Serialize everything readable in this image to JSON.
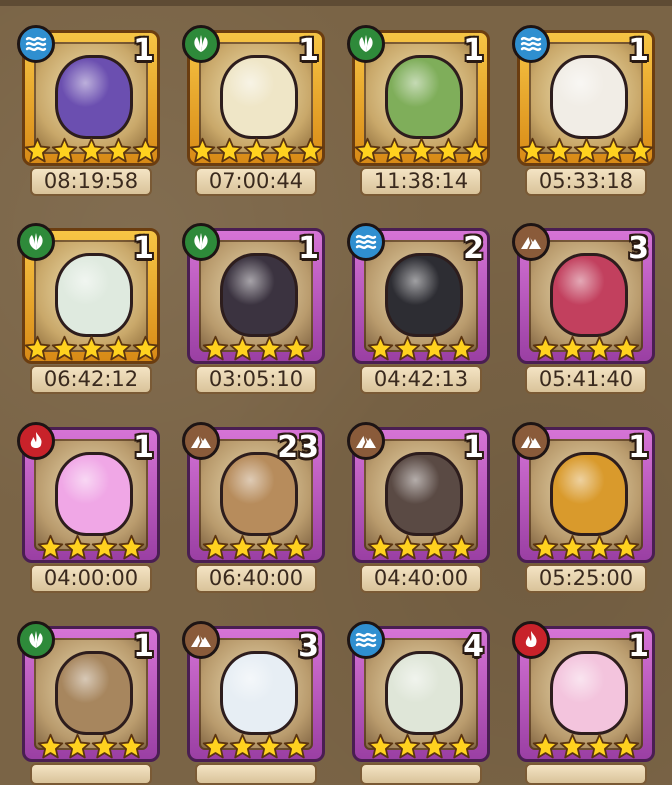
{
  "colors": {
    "background": "#7a6446",
    "gold_frame": "#f7c545",
    "purple_frame": "#d674d6",
    "star": "#ffd21f",
    "water": "#2f8fd0",
    "grass": "#2e8a3a",
    "fire": "#c8222a",
    "earth": "#8a5b3a"
  },
  "eggs": [
    {
      "element": "water",
      "element_icon": "water-waves-icon",
      "frame": "gold",
      "stars": 5,
      "count": "1",
      "timer": "08:19:58",
      "art": "pocket-watch-egg",
      "art_color": "#6b4fb0"
    },
    {
      "element": "grass",
      "element_icon": "leaf-icon",
      "frame": "gold",
      "stars": 5,
      "count": "1",
      "timer": "07:00:44",
      "art": "seed-sack-egg",
      "art_color": "#efe6c7"
    },
    {
      "element": "grass",
      "element_icon": "leaf-icon",
      "frame": "gold",
      "stars": 5,
      "count": "1",
      "timer": "11:38:14",
      "art": "green-egg-on-cloth",
      "art_color": "#7fae5a"
    },
    {
      "element": "water",
      "element_icon": "water-waves-icon",
      "frame": "gold",
      "stars": 5,
      "count": "1",
      "timer": "05:33:18",
      "art": "winged-angel-egg",
      "art_color": "#f1ede6"
    },
    {
      "element": "grass",
      "element_icon": "leaf-icon",
      "frame": "gold",
      "stars": 5,
      "count": "1",
      "timer": "06:42:12",
      "art": "leafy-white-egg",
      "art_color": "#dfeadf"
    },
    {
      "element": "grass",
      "element_icon": "leaf-icon",
      "frame": "purple",
      "stars": 4,
      "count": "1",
      "timer": "03:05:10",
      "art": "horned-dark-egg",
      "art_color": "#3b3340"
    },
    {
      "element": "water",
      "element_icon": "water-waves-icon",
      "frame": "purple",
      "stars": 4,
      "count": "2",
      "timer": "04:42:13",
      "art": "spiked-black-egg",
      "art_color": "#2d2d33"
    },
    {
      "element": "earth",
      "element_icon": "mountain-icon",
      "frame": "purple",
      "stars": 4,
      "count": "3",
      "timer": "05:41:40",
      "art": "thorn-pink-egg",
      "art_color": "#c2405e"
    },
    {
      "element": "fire",
      "element_icon": "flame-icon",
      "frame": "purple",
      "stars": 4,
      "count": "1",
      "timer": "04:00:00",
      "art": "pink-slime-egg",
      "art_color": "#f0a7e6"
    },
    {
      "element": "earth",
      "element_icon": "mountain-icon",
      "frame": "purple",
      "stars": 4,
      "count": "23",
      "timer": "06:40:00",
      "art": "vine-wrapped-egg",
      "art_color": "#b78c5c"
    },
    {
      "element": "earth",
      "element_icon": "mountain-icon",
      "frame": "purple",
      "stars": 4,
      "count": "1",
      "timer": "04:40:00",
      "art": "brown-bear-egg",
      "art_color": "#5a4a44"
    },
    {
      "element": "earth",
      "element_icon": "mountain-icon",
      "frame": "purple",
      "stars": 4,
      "count": "1",
      "timer": "05:25:00",
      "art": "furry-gem-egg",
      "art_color": "#d99a2c"
    },
    {
      "element": "grass",
      "element_icon": "leaf-icon",
      "frame": "purple",
      "stars": 4,
      "count": "1",
      "timer": "",
      "art": "striped-nest-egg",
      "art_color": "#a7865e"
    },
    {
      "element": "earth",
      "element_icon": "mountain-icon",
      "frame": "purple",
      "stars": 4,
      "count": "3",
      "timer": "",
      "art": "blue-pattern-egg",
      "art_color": "#e7eef4"
    },
    {
      "element": "water",
      "element_icon": "water-waves-icon",
      "frame": "purple",
      "stars": 4,
      "count": "4",
      "timer": "",
      "art": "feathered-egg",
      "art_color": "#dfe6d8"
    },
    {
      "element": "fire",
      "element_icon": "flame-icon",
      "frame": "purple",
      "stars": 4,
      "count": "1",
      "timer": "",
      "art": "pink-bat-egg",
      "art_color": "#f3c4dd"
    }
  ]
}
